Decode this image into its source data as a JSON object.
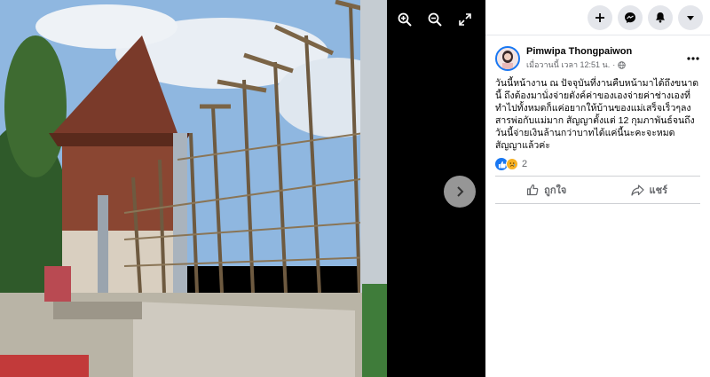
{
  "viewer": {
    "tools": [
      {
        "icon": "zoom-in-icon"
      },
      {
        "icon": "zoom-out-icon"
      },
      {
        "icon": "fullscreen-icon"
      }
    ],
    "next_icon": "chevron-right-icon"
  },
  "topbar": {
    "buttons": [
      "plus-icon",
      "messenger-icon",
      "bell-icon",
      "caret-down-icon"
    ]
  },
  "post": {
    "author": "Pimwipa Thongpaiwon",
    "time": "เมื่อวานนี้ เวลา 12:51 น.",
    "privacy_icon": "globe-icon",
    "text": "วันนี้หน้างาน ณ ปัจจุบันที่งานคืบหน้ามาได้ถึงขนาดนี้ ถึงต้องมานั่งจ่ายตังค์ค่าของเองจ่ายค่าช่างเองที่ทำไปทั้งหมดก็แค่อยากให้บ้านของแม่เสร็จเร็วๆลงสารพ่อกับแม่มาก สัญญาตั้งแต่ 12 กุมภาพันธ์จนถึงวันนี้จ่ายเงินล้านกว่าบาทได้แค่นี้นะคะจะหมดสัญญาแล้วค่ะ",
    "reaction_count": "2",
    "like_label": "ถูกใจ",
    "share_label": "แชร์"
  },
  "colors": {
    "brand": "#1877f2",
    "sad": "#f7b125",
    "muted": "#65676b"
  }
}
